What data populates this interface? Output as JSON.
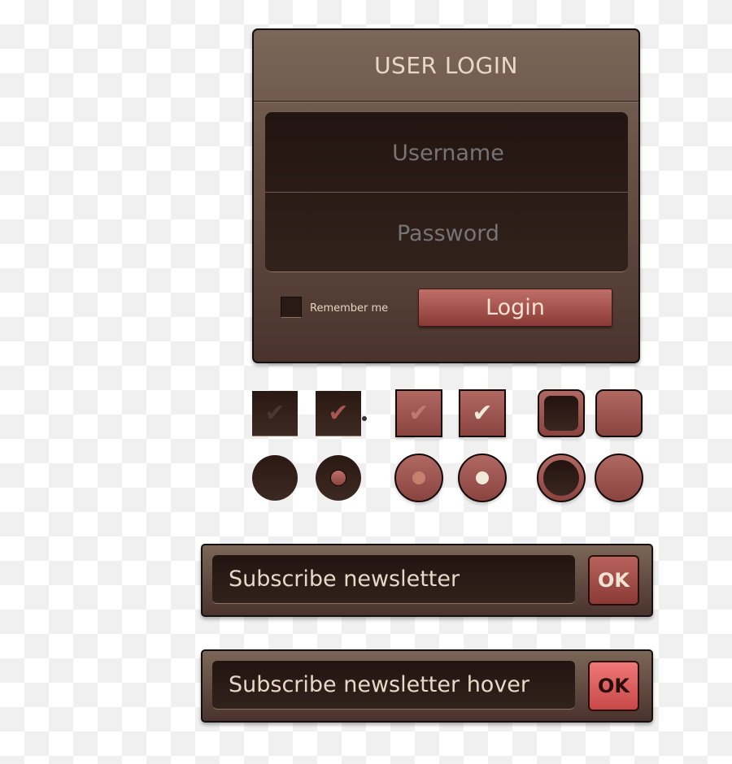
{
  "login": {
    "title": "USER LOGIN",
    "username_placeholder": "Username",
    "password_placeholder": "Password",
    "remember_label": "Remember me",
    "login_label": "Login"
  },
  "newsletter": [
    {
      "text": "Subscribe newsletter",
      "ok": "OK"
    },
    {
      "text": "Subscribe newsletter hover",
      "ok": "OK"
    }
  ],
  "colors": {
    "panel": "#6a5246",
    "field": "#2a1a15",
    "accent": "#a8524c",
    "text": "#e8d8c8"
  }
}
